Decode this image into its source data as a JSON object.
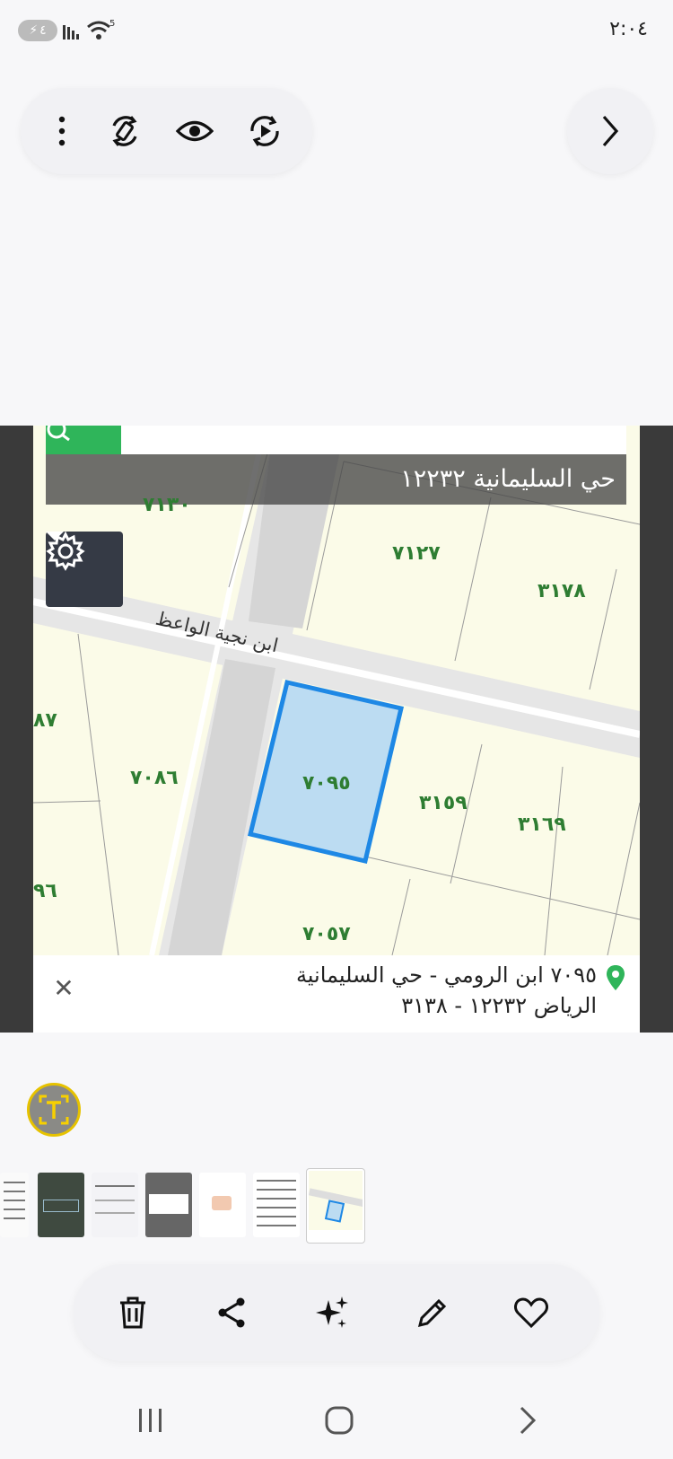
{
  "status_bar": {
    "time": "٢:٠٤",
    "battery_level": "٤",
    "wifi_badge": "5"
  },
  "toolbar": {
    "more_icon": "more-vertical-icon",
    "rotate_icon": "auto-rotate-icon",
    "view_icon": "eye-icon",
    "play_icon": "play-rotate-icon",
    "next_icon": "chevron-right-icon"
  },
  "map": {
    "district_title": "حي السليمانية ١٢٢٣٢",
    "street_name": "ابن نجية الواعظ",
    "lots": [
      "٧١٣٠",
      "٧١٢٧",
      "٣١٧٨",
      "٧٠٨٦",
      "٧٠٩٥",
      "٣١٥٩",
      "٣١٦٩",
      "٧٠٥٧",
      "٨٧",
      "٩٦"
    ],
    "selected_lot": "٧٠٩٥",
    "selected_color": "#1e88e5",
    "address_line1": "٧٠٩٥ ابن الرومي - حي السليمانية",
    "address_line2": "الرياض ١٢٢٣٢ - ٣١٣٨",
    "close_label": "✕"
  },
  "thumbnails_count": 7,
  "actions": {
    "delete": "trash-icon",
    "share": "share-icon",
    "enhance": "sparkle-icon",
    "edit": "pencil-icon",
    "favorite": "heart-icon"
  },
  "nav": {
    "recents": "|||",
    "home": "home",
    "back": "back"
  }
}
